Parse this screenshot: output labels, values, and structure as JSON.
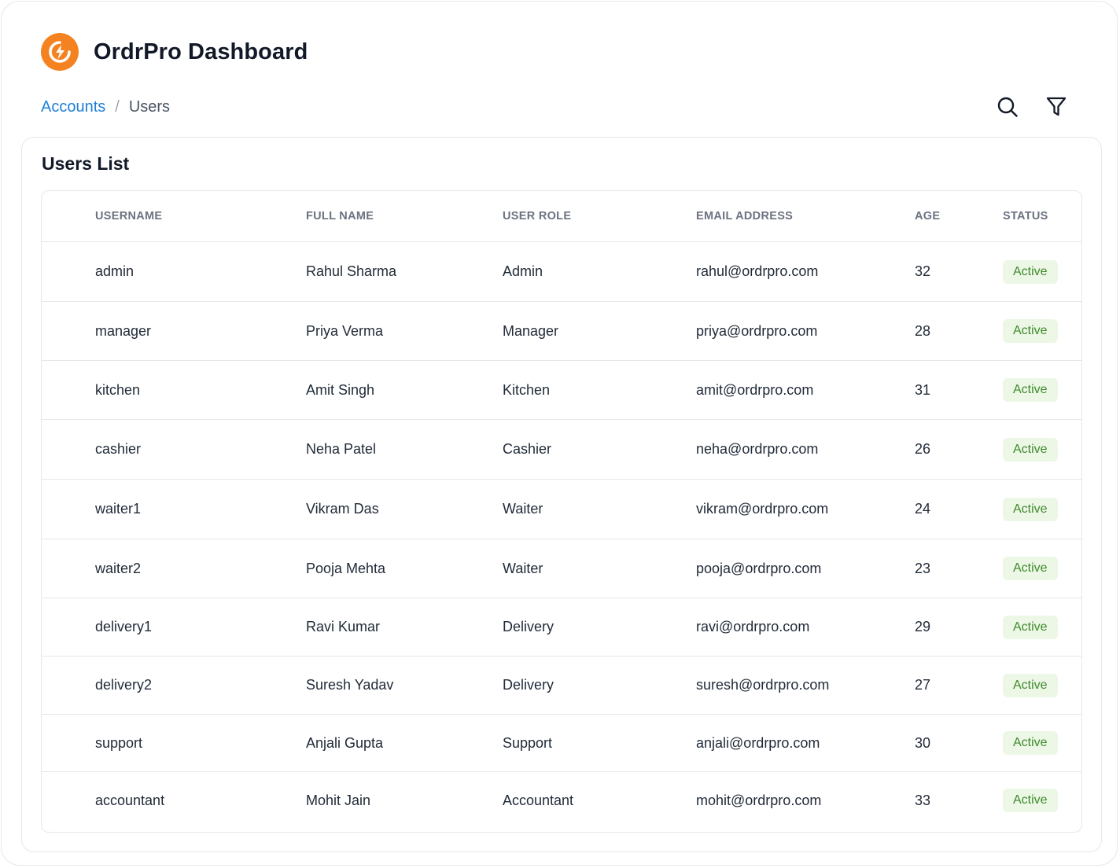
{
  "app": {
    "title": "OrdrPro Dashboard",
    "logo_icon": "ordrpro-logo-icon",
    "brand_color": "#f58220"
  },
  "breadcrumb": {
    "link": "Accounts",
    "separator": "/",
    "current": "Users"
  },
  "toolbar": {
    "search_icon": "search-icon",
    "filter_icon": "filter-icon"
  },
  "card": {
    "title": "Users List"
  },
  "table": {
    "columns": [
      "USERNAME",
      "FULL NAME",
      "USER ROLE",
      "EMAIL ADDRESS",
      "AGE",
      "STATUS"
    ],
    "rows": [
      {
        "username": "admin",
        "full_name": "Rahul Sharma",
        "role": "Admin",
        "email": "rahul@ordrpro.com",
        "age": "32",
        "status": "Active"
      },
      {
        "username": "manager",
        "full_name": "Priya Verma",
        "role": "Manager",
        "email": "priya@ordrpro.com",
        "age": "28",
        "status": "Active"
      },
      {
        "username": "kitchen",
        "full_name": "Amit Singh",
        "role": "Kitchen",
        "email": "amit@ordrpro.com",
        "age": "31",
        "status": "Active"
      },
      {
        "username": "cashier",
        "full_name": "Neha Patel",
        "role": "Cashier",
        "email": "neha@ordrpro.com",
        "age": "26",
        "status": "Active"
      },
      {
        "username": "waiter1",
        "full_name": "Vikram Das",
        "role": "Waiter",
        "email": "vikram@ordrpro.com",
        "age": "24",
        "status": "Active"
      },
      {
        "username": "waiter2",
        "full_name": "Pooja Mehta",
        "role": "Waiter",
        "email": "pooja@ordrpro.com",
        "age": "23",
        "status": "Active"
      },
      {
        "username": "delivery1",
        "full_name": "Ravi Kumar",
        "role": "Delivery",
        "email": "ravi@ordrpro.com",
        "age": "29",
        "status": "Active"
      },
      {
        "username": "delivery2",
        "full_name": "Suresh Yadav",
        "role": "Delivery",
        "email": "suresh@ordrpro.com",
        "age": "27",
        "status": "Active"
      },
      {
        "username": "support",
        "full_name": "Anjali Gupta",
        "role": "Support",
        "email": "anjali@ordrpro.com",
        "age": "30",
        "status": "Active"
      },
      {
        "username": "accountant",
        "full_name": "Mohit Jain",
        "role": "Accountant",
        "email": "mohit@ordrpro.com",
        "age": "33",
        "status": "Active"
      }
    ]
  },
  "colors": {
    "link": "#1e7fd8",
    "status_active_bg": "#ecf7e6",
    "status_active_text": "#3f8a2c"
  }
}
